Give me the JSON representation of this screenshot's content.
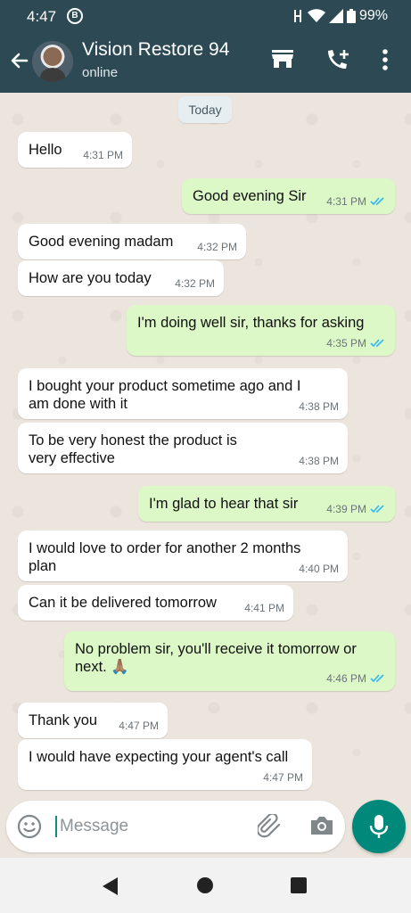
{
  "status_bar": {
    "time": "4:47",
    "app_badge": "B",
    "battery": "99%"
  },
  "header": {
    "contact_name": "Vision Restore 94",
    "status": "online"
  },
  "chat": {
    "day_label": "Today",
    "messages": [
      {
        "dir": "in",
        "text": "Hello",
        "time": "4:31 PM"
      },
      {
        "dir": "out",
        "text": "Good evening Sir",
        "time": "4:31 PM",
        "read": true
      },
      {
        "dir": "in",
        "text": "Good evening madam",
        "time": "4:32 PM"
      },
      {
        "dir": "in",
        "text": "How are you today",
        "time": "4:32 PM"
      },
      {
        "dir": "out",
        "text": "I'm doing well sir, thanks for asking",
        "time": "4:35 PM",
        "read": true
      },
      {
        "dir": "in",
        "text": "I bought your product sometime ago and I am done with it",
        "time": "4:38 PM"
      },
      {
        "dir": "in",
        "text": "To be very honest the product is very effective",
        "time": "4:38 PM"
      },
      {
        "dir": "out",
        "text": "I'm glad to hear that sir",
        "time": "4:39 PM",
        "read": true
      },
      {
        "dir": "in",
        "text": "I would love to order for another 2 months plan",
        "time": "4:40 PM"
      },
      {
        "dir": "in",
        "text": "Can it be delivered tomorrow",
        "time": "4:41 PM"
      },
      {
        "dir": "out",
        "text": "No problem sir, you'll receive it tomorrow or next. 🙏🏽",
        "time": "4:46 PM",
        "read": true
      },
      {
        "dir": "in",
        "text": "Thank you",
        "time": "4:47 PM"
      },
      {
        "dir": "in",
        "text": "I would have expecting your agent's call",
        "time": "4:47 PM"
      }
    ]
  },
  "composer": {
    "placeholder": "Message"
  },
  "colors": {
    "header": "#2d4a54",
    "outgoing": "#dcf8c6",
    "incoming": "#ffffff",
    "read_ticks": "#34b7f1",
    "mic": "#00897b"
  },
  "icons": [
    "back-arrow-icon",
    "store-icon",
    "add-call-icon",
    "more-vert-icon",
    "emoji-icon",
    "attach-icon",
    "camera-icon",
    "mic-icon",
    "nav-back-icon",
    "nav-home-icon",
    "nav-recents-icon"
  ]
}
